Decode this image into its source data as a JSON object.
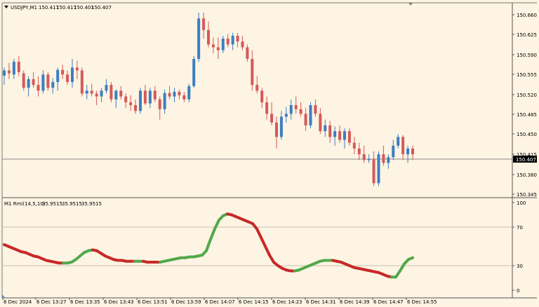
{
  "symbol_info": {
    "symbol": "USDJPY,M1",
    "open": "150.417",
    "high": "150.417",
    "low": "150.401",
    "close": "150.407"
  },
  "indicator_info": {
    "name": "M1 Rmi(14,5,10)",
    "values": [
      "35.9515",
      "35.9515",
      "35.9515"
    ]
  },
  "price_axis": {
    "labels": [
      "150.660",
      "150.625",
      "150.590",
      "150.555",
      "150.520",
      "150.485",
      "150.450",
      "150.415",
      "150.380",
      "150.345"
    ],
    "current_price": "150.407"
  },
  "indicator_axis": {
    "labels": [
      "100",
      "70",
      "30",
      "0"
    ]
  },
  "time_axis": {
    "labels": [
      "6 Dec 2024",
      "6 Dec 13:27",
      "6 Dec 13:35",
      "6 Dec 13:43",
      "6 Dec 13:51",
      "6 Dec 13:59",
      "6 Dec 14:07",
      "6 Dec 14:15",
      "6 Dec 14:23",
      "6 Dec 14:31",
      "6 Dec 14:39",
      "6 Dec 14:47",
      "6 Dec 14:55"
    ]
  },
  "colors": {
    "background": "#FDF4E3",
    "bull_candle": "#3D7EC0",
    "bear_candle": "#D45A5A",
    "doji_candle": "#2EA82E",
    "rmi_up": "#52A84A",
    "rmi_down": "#C82828",
    "grid_line": "#C8C0B0",
    "axis_line": "#555555",
    "price_line": "#8A8A8A"
  },
  "chart_data": {
    "type": "candlestick",
    "title": "USDJPY,M1",
    "price_ylim": [
      150.335,
      150.672
    ],
    "candles": [
      [
        150.546,
        150.56,
        150.53,
        150.555
      ],
      [
        150.555,
        150.568,
        150.54,
        150.55
      ],
      [
        150.548,
        150.575,
        150.54,
        150.57
      ],
      [
        150.57,
        150.58,
        150.545,
        150.552
      ],
      [
        150.55,
        150.555,
        150.52,
        150.525
      ],
      [
        150.525,
        150.545,
        150.51,
        150.54
      ],
      [
        150.54,
        150.552,
        150.525,
        150.53
      ],
      [
        150.53,
        150.545,
        150.51,
        150.52
      ],
      [
        150.52,
        150.555,
        150.515,
        150.548
      ],
      [
        150.548,
        150.552,
        150.52,
        150.525
      ],
      [
        150.525,
        150.542,
        150.515,
        150.535
      ],
      [
        150.535,
        150.56,
        150.52,
        150.556
      ],
      [
        150.556,
        150.565,
        150.54,
        150.548
      ],
      [
        150.548,
        150.555,
        150.53,
        150.535
      ],
      [
        150.535,
        150.575,
        150.525,
        150.56
      ],
      [
        150.56,
        150.572,
        150.54,
        150.555
      ],
      [
        150.555,
        150.56,
        150.51,
        150.515
      ],
      [
        150.515,
        150.53,
        150.505,
        150.52
      ],
      [
        150.52,
        150.532,
        150.51,
        150.515
      ],
      [
        150.515,
        150.52,
        150.495,
        150.51
      ],
      [
        150.51,
        150.525,
        150.5,
        150.52
      ],
      [
        150.52,
        150.54,
        150.515,
        150.53
      ],
      [
        150.53,
        150.535,
        150.5,
        150.505
      ],
      [
        150.505,
        150.522,
        150.49,
        150.52
      ],
      [
        150.52,
        150.528,
        150.505,
        150.51
      ],
      [
        150.51,
        150.515,
        150.49,
        150.5
      ],
      [
        150.5,
        150.512,
        150.485,
        150.495
      ],
      [
        150.495,
        150.505,
        150.48,
        150.485
      ],
      [
        150.485,
        150.525,
        150.48,
        150.52
      ],
      [
        150.52,
        150.53,
        150.495,
        150.498
      ],
      [
        150.498,
        150.525,
        150.49,
        150.52
      ],
      [
        150.52,
        150.528,
        150.5,
        150.505
      ],
      [
        150.505,
        150.51,
        150.47,
        150.488
      ],
      [
        150.488,
        150.522,
        150.48,
        150.516
      ],
      [
        150.516,
        150.528,
        150.505,
        150.51
      ],
      [
        150.51,
        150.525,
        150.5,
        150.518
      ],
      [
        150.518,
        150.522,
        150.505,
        150.512
      ],
      [
        150.512,
        150.518,
        150.5,
        150.505
      ],
      [
        150.505,
        150.532,
        150.5,
        150.528
      ],
      [
        150.528,
        150.58,
        150.525,
        150.575
      ],
      [
        150.575,
        150.655,
        150.57,
        150.645
      ],
      [
        150.645,
        150.655,
        150.61,
        150.625
      ],
      [
        150.625,
        150.64,
        150.595,
        150.6
      ],
      [
        150.6,
        150.612,
        150.585,
        150.595
      ],
      [
        150.595,
        150.612,
        150.575,
        150.59
      ],
      [
        150.59,
        150.615,
        150.585,
        150.61
      ],
      [
        150.61,
        150.618,
        150.595,
        150.6
      ],
      [
        150.6,
        150.62,
        150.59,
        150.615
      ],
      [
        150.615,
        150.62,
        150.595,
        150.605
      ],
      [
        150.605,
        150.615,
        150.59,
        150.595
      ],
      [
        150.595,
        150.6,
        150.57,
        150.575
      ],
      [
        150.575,
        150.59,
        150.52,
        150.53
      ],
      [
        150.53,
        150.545,
        150.515,
        150.52
      ],
      [
        150.52,
        150.525,
        150.49,
        150.5
      ],
      [
        150.5,
        150.51,
        150.47,
        150.48
      ],
      [
        150.48,
        150.5,
        150.46,
        150.465
      ],
      [
        150.465,
        150.475,
        150.42,
        150.44
      ],
      [
        150.44,
        150.485,
        150.435,
        150.475
      ],
      [
        150.475,
        150.492,
        150.465,
        150.48
      ],
      [
        150.48,
        150.505,
        150.47,
        150.495
      ],
      [
        150.495,
        150.51,
        150.48,
        150.488
      ],
      [
        150.488,
        150.5,
        150.475,
        150.48
      ],
      [
        150.48,
        150.49,
        150.45,
        150.46
      ],
      [
        150.46,
        150.5,
        150.455,
        150.495
      ],
      [
        150.495,
        150.505,
        150.475,
        150.48
      ],
      [
        150.48,
        150.49,
        150.445,
        150.45
      ],
      [
        150.45,
        150.47,
        150.44,
        150.46
      ],
      [
        150.46,
        150.468,
        150.43,
        150.44
      ],
      [
        150.44,
        150.458,
        150.425,
        150.45
      ],
      [
        150.45,
        150.46,
        150.43,
        150.435
      ],
      [
        150.435,
        150.455,
        150.42,
        150.45
      ],
      [
        150.45,
        150.455,
        150.425,
        150.43
      ],
      [
        150.43,
        150.44,
        150.41,
        150.42
      ],
      [
        150.42,
        150.43,
        150.4,
        150.41
      ],
      [
        150.41,
        150.425,
        150.395,
        150.4
      ],
      [
        150.4,
        150.41,
        150.395,
        150.402
      ],
      [
        150.402,
        150.415,
        150.355,
        150.36
      ],
      [
        150.36,
        150.415,
        150.355,
        150.41
      ],
      [
        150.41,
        150.425,
        150.39,
        150.395
      ],
      [
        150.395,
        150.41,
        150.385,
        150.405
      ],
      [
        150.405,
        150.435,
        150.4,
        150.425
      ],
      [
        150.425,
        150.445,
        150.42,
        150.44
      ],
      [
        150.44,
        150.443,
        150.4,
        150.41
      ],
      [
        150.41,
        150.425,
        150.395,
        150.42
      ],
      [
        150.42,
        150.425,
        150.4,
        150.41
      ]
    ],
    "rmi": {
      "ylim": [
        0,
        100
      ],
      "levels": [
        70,
        30
      ],
      "values": [
        52,
        50,
        48,
        46,
        44,
        43,
        41,
        39,
        38,
        36,
        34,
        33,
        32,
        31,
        31,
        31,
        32,
        35,
        39,
        43,
        45,
        46,
        45,
        42,
        39,
        37,
        35,
        34,
        34,
        33,
        33,
        33,
        33,
        33,
        32,
        32,
        32,
        32,
        33,
        34,
        35,
        36,
        37,
        37,
        38,
        38,
        39,
        40,
        45,
        58,
        70,
        80,
        85,
        87,
        86,
        84,
        82,
        80,
        78,
        76,
        70,
        60,
        50,
        40,
        32,
        28,
        25,
        23,
        22,
        22,
        23,
        25,
        27,
        29,
        31,
        33,
        34,
        34,
        34,
        33,
        32,
        30,
        28,
        26,
        25,
        24,
        23,
        22,
        21,
        20,
        18,
        16,
        15,
        15,
        22,
        30,
        35,
        37
      ],
      "colors": [
        "down",
        "down",
        "down",
        "down",
        "down",
        "down",
        "down",
        "down",
        "down",
        "down",
        "down",
        "down",
        "down",
        "down",
        "up",
        "up",
        "up",
        "up",
        "up",
        "up",
        "up",
        "down",
        "down",
        "down",
        "down",
        "down",
        "down",
        "down",
        "down",
        "down",
        "down",
        "up",
        "up",
        "down",
        "down",
        "down",
        "down",
        "up",
        "up",
        "up",
        "up",
        "up",
        "up",
        "up",
        "up",
        "up",
        "up",
        "up",
        "up",
        "up",
        "up",
        "up",
        "up",
        "down",
        "down",
        "down",
        "down",
        "down",
        "down",
        "down",
        "down",
        "down",
        "down",
        "down",
        "down",
        "down",
        "down",
        "down",
        "down",
        "up",
        "up",
        "up",
        "up",
        "up",
        "up",
        "up",
        "up",
        "up",
        "down",
        "down",
        "down",
        "down",
        "down",
        "down",
        "down",
        "down",
        "down",
        "down",
        "down",
        "down",
        "down",
        "down",
        "up",
        "up",
        "up",
        "up",
        "up",
        "up"
      ]
    }
  }
}
